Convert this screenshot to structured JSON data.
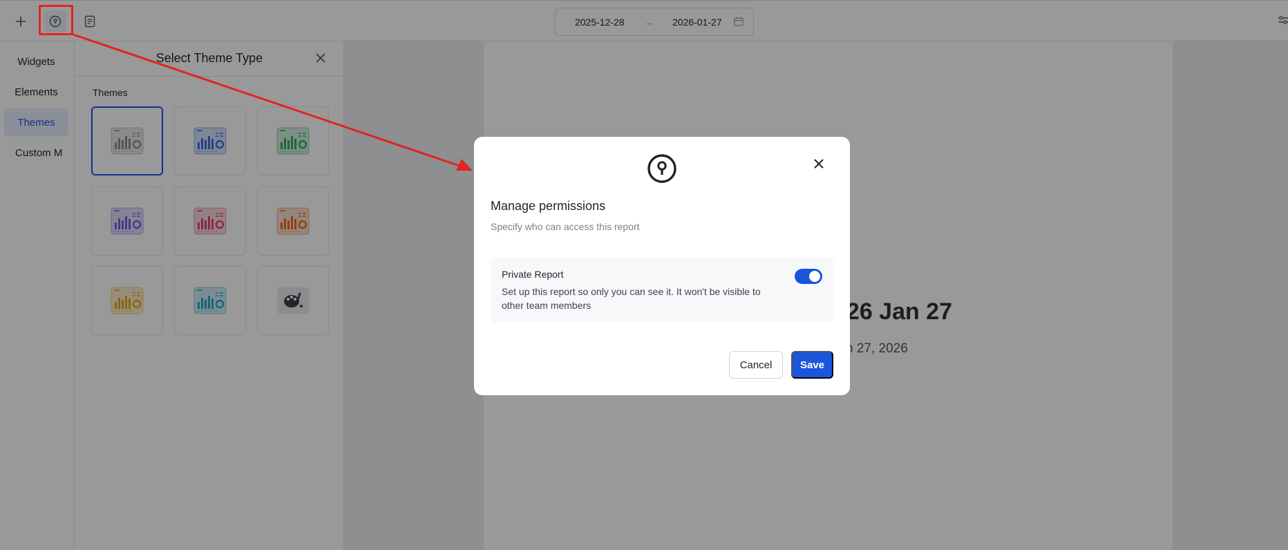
{
  "toolbar": {
    "add_icon": "plus-icon",
    "permissions_icon": "lock-icon",
    "report_icon": "report-icon",
    "date_start": "2025-12-28",
    "date_end": "2026-01-27",
    "date_arrow": "→"
  },
  "leftnav": {
    "items": [
      {
        "label": "Widgets"
      },
      {
        "label": "Elements"
      },
      {
        "label": "Themes",
        "active": true
      },
      {
        "label": "Custom M"
      }
    ]
  },
  "theme_panel": {
    "title": "Select Theme Type",
    "section_label": "Themes",
    "themes": [
      {
        "color": "#8a8d93",
        "selected": true
      },
      {
        "color": "#3b6fe0"
      },
      {
        "color": "#2fae5f"
      },
      {
        "color": "#7d5ce6"
      },
      {
        "color": "#e0466f"
      },
      {
        "color": "#ea6b1f"
      },
      {
        "color": "#e6a817"
      },
      {
        "color": "#22a9c7"
      },
      {
        "color": "#3d3f45",
        "custom": true
      }
    ]
  },
  "report": {
    "title": "026 Jan 27",
    "subtitle": "n 27, 2026"
  },
  "modal": {
    "title": "Manage permissions",
    "subtitle": "Specify who can access this report",
    "setting_label": "Private Report",
    "setting_description": "Set up this report so only you can see it. It won't be visible to other team members",
    "toggle_on": true,
    "cancel_label": "Cancel",
    "save_label": "Save"
  },
  "colors": {
    "accent": "#1a56db",
    "highlight": "#e02424"
  }
}
